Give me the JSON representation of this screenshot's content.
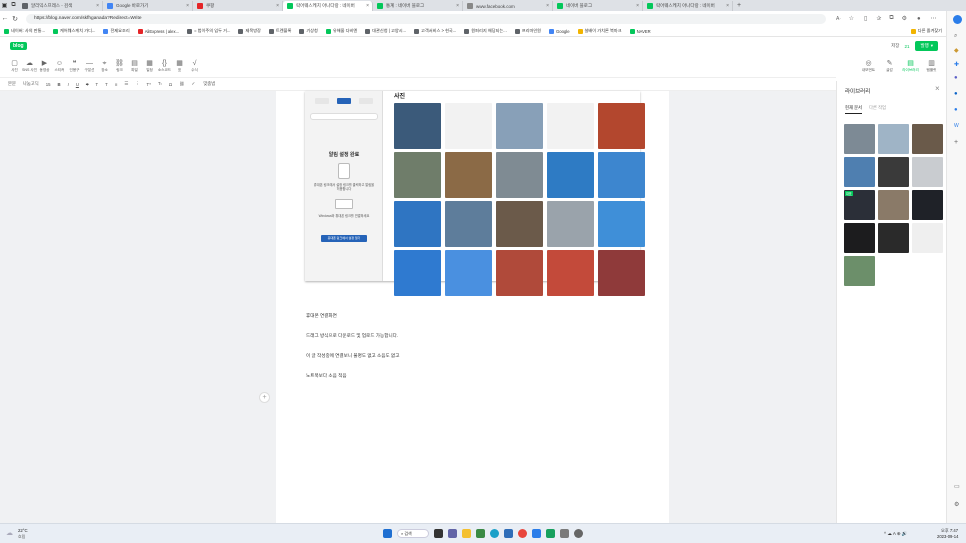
{
  "tabs": [
    {
      "label": "알리익스프레스 - 검색",
      "color": "#5f6368",
      "active": false
    },
    {
      "label": "Google 바로가기",
      "color": "#4285f4",
      "active": false
    },
    {
      "label": "쿠팡",
      "color": "#e52528",
      "active": false
    },
    {
      "label": "락어웨스케치 아나다랑 : 네이버",
      "color": "#03c75a",
      "active": true
    },
    {
      "label": "통계 : 네이버 블로그",
      "color": "#03c75a",
      "active": false
    },
    {
      "label": "www.facebook.com",
      "color": "#888888",
      "active": false
    },
    {
      "label": "네이버 블로그",
      "color": "#03c75a",
      "active": false
    },
    {
      "label": "락어웨스케치 아나다랑 : 네이버",
      "color": "#03c75a",
      "active": false
    }
  ],
  "new_tab_label": "+",
  "address": {
    "url": "https://blog.naver.com/skfhganada?Redirect=Write"
  },
  "bookmarks": [
    {
      "label": "네이버: 사의 판통...",
      "color": "#03c75a"
    },
    {
      "label": "케어웨스케치 가디...",
      "color": "#03c75a"
    },
    {
      "label": "전제요조리",
      "color": "#4285f4"
    },
    {
      "label": "AliExpress | alex...",
      "color": "#e52528"
    },
    {
      "label": "= 법이주의 임두 거...",
      "color": "#5f6368"
    },
    {
      "label": "제목방장",
      "color": "#5f6368"
    },
    {
      "label": "트렌블록",
      "color": "#5f6368"
    },
    {
      "label": "기상청",
      "color": "#5f6368"
    },
    {
      "label": "유해울 다비엔",
      "color": "#03c75a"
    },
    {
      "label": "대관신청 | 고양시...",
      "color": "#5f6368"
    },
    {
      "label": "고객서비스 > 현국...",
      "color": "#5f6368"
    },
    {
      "label": "원퍼리지 해당되는...",
      "color": "#5f6368"
    },
    {
      "label": "프리마인원",
      "color": "#5f6368"
    },
    {
      "label": "Google",
      "color": "#4285f4"
    },
    {
      "label": "설배이 가치론 북마크",
      "color": "#f2b400"
    },
    {
      "label": "NAVER",
      "color": "#03c75a"
    }
  ],
  "other_bookmarks": "다른 즐겨찾기",
  "editor": {
    "logo": "blog",
    "save_label": "저장",
    "save_count": "21",
    "publish_label": "발행"
  },
  "toolbar": [
    {
      "label": "사진",
      "icon": "photo-icon"
    },
    {
      "label": "SNS 사진",
      "icon": "cloud-icon"
    },
    {
      "label": "동영상",
      "icon": "video-icon"
    },
    {
      "label": "스티커",
      "icon": "sticker-icon"
    },
    {
      "label": "인용구",
      "icon": "quote-icon"
    },
    {
      "label": "구분선",
      "icon": "divider-icon"
    },
    {
      "label": "장소",
      "icon": "place-icon"
    },
    {
      "label": "링크",
      "icon": "link-icon"
    },
    {
      "label": "파일",
      "icon": "file-icon"
    },
    {
      "label": "일정",
      "icon": "schedule-icon"
    },
    {
      "label": "소스코드",
      "icon": "code-icon"
    },
    {
      "label": "표",
      "icon": "table-icon"
    },
    {
      "label": "수식",
      "icon": "formula-icon"
    }
  ],
  "right_tools": [
    {
      "label": "내모먼트",
      "icon": "moment-icon"
    },
    {
      "label": "글감",
      "icon": "material-icon"
    },
    {
      "label": "라이브러리",
      "icon": "library-icon",
      "active": true
    },
    {
      "label": "템플릿",
      "icon": "template-icon"
    }
  ],
  "format": {
    "style": "본문",
    "font": "나눔고딕",
    "size": "15",
    "spell": "맞춤법"
  },
  "screenshot": {
    "title": "사진",
    "phone_heading": "알림 설정 완료",
    "phone_step1": "휴대폰 링크에서 설정 링크를 클릭하고 알림을 허용합니다",
    "phone_step2": "Windows와 휴대폰 링크를 연결하세요",
    "phone_button": "휴대폰 링크에서 설정 열기"
  },
  "paragraphs": [
    "휴대폰 연결화면",
    "드래그 방식으로 다운로드 및 업로드 가능합니다.",
    "이 글 작성중에 연결보니 불명도 없고 소음도 없고",
    "노트북보다 소음 적음"
  ],
  "library": {
    "title": "라이브러리",
    "tab_current": "현재 문서",
    "tab_other": "다른 작업",
    "badge": "대표"
  },
  "colors": {
    "accent": "#03c75a",
    "taskbar": "#e9eef5"
  },
  "taskbar": {
    "weather_temp": "22°C",
    "weather_desc": "흐림",
    "search": "검색",
    "tray": "^  ☁  A  ⊕  🔊",
    "time": "오후 7:47",
    "date": "2023-09-14"
  }
}
